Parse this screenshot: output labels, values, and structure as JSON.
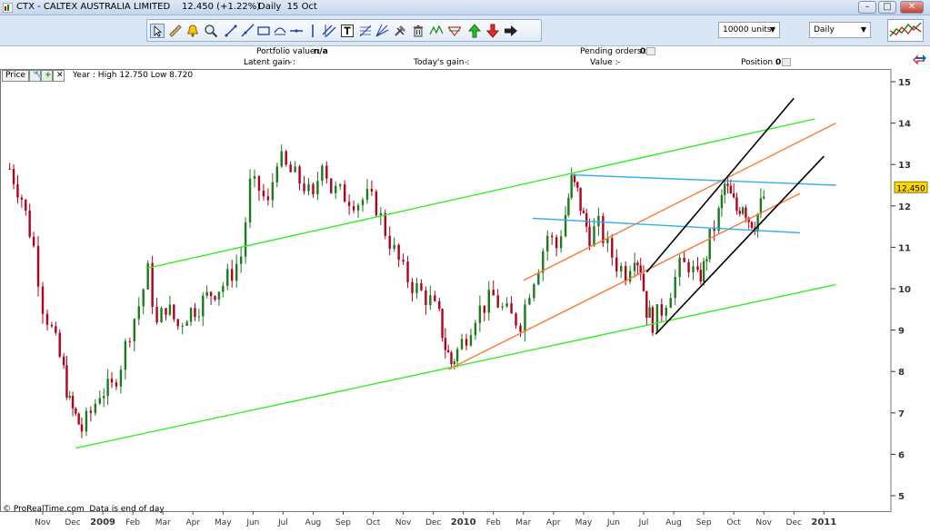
{
  "window": {
    "title": "CTX - CALTEX AUSTRALIA LIMITED",
    "price": "12.450 (+1.22%)",
    "period": "Daily  15 Oct",
    "min": "–",
    "max": "□",
    "close": "✕"
  },
  "toolbar": {
    "units": "10000 units",
    "timeframe": "Daily"
  },
  "info": {
    "portfolio_label": "Portfolio value :",
    "portfolio_value": "n/a",
    "latent_label": "Latent gain :",
    "latent_value": "-",
    "today_label": "Today's gain :",
    "today_value": "-",
    "pending_label": "Pending orders :",
    "pending_value": "0",
    "value_label": "Value :",
    "value_value": "-",
    "position_label": "Position :",
    "position_value": "0"
  },
  "legend": {
    "price": "Price",
    "year": "Year : High 12.750 Low 8.720"
  },
  "footer": "© ProRealTime.com  Data is end of day",
  "colors": {
    "up": "#1b7a1b",
    "down": "#b3001b",
    "green_line": "#33ee22",
    "orange_line": "#ff7733",
    "blue_line": "#33aaee",
    "black_line": "#000000",
    "price_tag": "#ffd700"
  },
  "chart_data": {
    "type": "candlestick",
    "y_ticks": [
      "5",
      "6",
      "7",
      "8",
      "9",
      "10",
      "11",
      "12",
      "13",
      "14",
      "15"
    ],
    "ylim": [
      4.7,
      15.5
    ],
    "last_price": "12.450",
    "x_labels": [
      "Nov",
      "Dec",
      "2009",
      "Feb",
      "Mar",
      "Apr",
      "May",
      "Jun",
      "Jul",
      "Aug",
      "Sep",
      "Oct",
      "Nov",
      "Dec",
      "2010",
      "Feb",
      "Mar",
      "Apr",
      "May",
      "Jun",
      "Jul",
      "Aug",
      "Sep",
      "Oct",
      "Nov",
      "Dec",
      "2011"
    ],
    "x_months": [
      0,
      1,
      2,
      3,
      4,
      5,
      6,
      7,
      8,
      9,
      10,
      11,
      12,
      13,
      14,
      15,
      16,
      17,
      18,
      19,
      20,
      21,
      22,
      23,
      24,
      25,
      26
    ],
    "xlim": [
      -0.5,
      26.4
    ],
    "price_path": [
      [
        -1.1,
        12.9
      ],
      [
        -0.7,
        12.2
      ],
      [
        -0.3,
        11.0
      ],
      [
        0.0,
        9.6
      ],
      [
        0.3,
        9.0
      ],
      [
        0.7,
        8.0
      ],
      [
        0.9,
        7.2
      ],
      [
        1.1,
        6.9
      ],
      [
        1.3,
        6.6
      ],
      [
        1.6,
        7.0
      ],
      [
        1.9,
        7.5
      ],
      [
        2.3,
        7.6
      ],
      [
        2.6,
        8.2
      ],
      [
        2.9,
        9.0
      ],
      [
        3.2,
        9.6
      ],
      [
        3.5,
        10.4
      ],
      [
        3.8,
        9.1
      ],
      [
        4.1,
        9.6
      ],
      [
        4.5,
        9.1
      ],
      [
        4.8,
        9.4
      ],
      [
        5.2,
        9.6
      ],
      [
        5.6,
        9.9
      ],
      [
        6.0,
        10.1
      ],
      [
        6.3,
        10.4
      ],
      [
        6.6,
        10.8
      ],
      [
        6.9,
        12.5
      ],
      [
        7.2,
        12.4
      ],
      [
        7.5,
        12.0
      ],
      [
        7.8,
        13.2
      ],
      [
        8.1,
        12.9
      ],
      [
        8.4,
        12.7
      ],
      [
        8.7,
        12.5
      ],
      [
        9.0,
        12.1
      ],
      [
        9.3,
        13.2
      ],
      [
        9.6,
        12.4
      ],
      [
        9.9,
        12.3
      ],
      [
        10.2,
        12.2
      ],
      [
        10.5,
        12.1
      ],
      [
        10.8,
        12.2
      ],
      [
        11.1,
        12.0
      ],
      [
        11.4,
        11.4
      ],
      [
        11.7,
        10.9
      ],
      [
        12.0,
        10.4
      ],
      [
        12.3,
        10.1
      ],
      [
        12.6,
        9.9
      ],
      [
        12.9,
        9.7
      ],
      [
        13.2,
        9.3
      ],
      [
        13.4,
        8.6
      ],
      [
        13.6,
        8.2
      ],
      [
        13.8,
        8.5
      ],
      [
        14.1,
        8.9
      ],
      [
        14.4,
        9.4
      ],
      [
        14.7,
        9.6
      ],
      [
        15.0,
        9.8
      ],
      [
        15.3,
        9.5
      ],
      [
        15.6,
        9.3
      ],
      [
        15.9,
        9.2
      ],
      [
        16.2,
        10.0
      ],
      [
        16.5,
        10.6
      ],
      [
        16.8,
        11.3
      ],
      [
        17.1,
        11.0
      ],
      [
        17.4,
        11.8
      ],
      [
        17.6,
        12.6
      ],
      [
        17.8,
        12.3
      ],
      [
        18.0,
        11.7
      ],
      [
        18.2,
        11.3
      ],
      [
        18.5,
        11.5
      ],
      [
        18.8,
        11.0
      ],
      [
        19.1,
        10.6
      ],
      [
        19.4,
        10.4
      ],
      [
        19.7,
        10.9
      ],
      [
        19.9,
        10.5
      ],
      [
        20.1,
        9.5
      ],
      [
        20.3,
        9.2
      ],
      [
        20.6,
        9.5
      ],
      [
        20.9,
        10.0
      ],
      [
        21.2,
        10.5
      ],
      [
        21.5,
        10.6
      ],
      [
        21.8,
        10.2
      ],
      [
        22.0,
        10.5
      ],
      [
        22.2,
        11.2
      ],
      [
        22.5,
        11.8
      ],
      [
        22.7,
        12.5
      ],
      [
        22.9,
        12.2
      ],
      [
        23.1,
        11.9
      ],
      [
        23.3,
        12.1
      ],
      [
        23.5,
        11.7
      ],
      [
        23.7,
        11.6
      ],
      [
        23.9,
        12.0
      ],
      [
        24.1,
        12.45
      ]
    ],
    "trendlines": [
      {
        "color": "green",
        "points": [
          [
            1.1,
            6.15
          ],
          [
            26.4,
            10.1
          ]
        ]
      },
      {
        "color": "green",
        "points": [
          [
            3.5,
            10.5
          ],
          [
            25.7,
            14.1
          ]
        ]
      },
      {
        "color": "orange",
        "points": [
          [
            13.5,
            8.05
          ],
          [
            25.2,
            12.3
          ]
        ]
      },
      {
        "color": "orange",
        "points": [
          [
            16.0,
            10.2
          ],
          [
            26.4,
            14.0
          ]
        ]
      },
      {
        "color": "blue",
        "points": [
          [
            17.6,
            12.75
          ],
          [
            26.4,
            12.5
          ]
        ]
      },
      {
        "color": "blue",
        "points": [
          [
            16.3,
            11.7
          ],
          [
            25.2,
            11.35
          ]
        ]
      },
      {
        "color": "black",
        "points": [
          [
            20.4,
            8.9
          ],
          [
            26.0,
            13.2
          ]
        ]
      },
      {
        "color": "black",
        "points": [
          [
            20.1,
            10.4
          ],
          [
            25.0,
            14.6
          ]
        ]
      }
    ]
  }
}
